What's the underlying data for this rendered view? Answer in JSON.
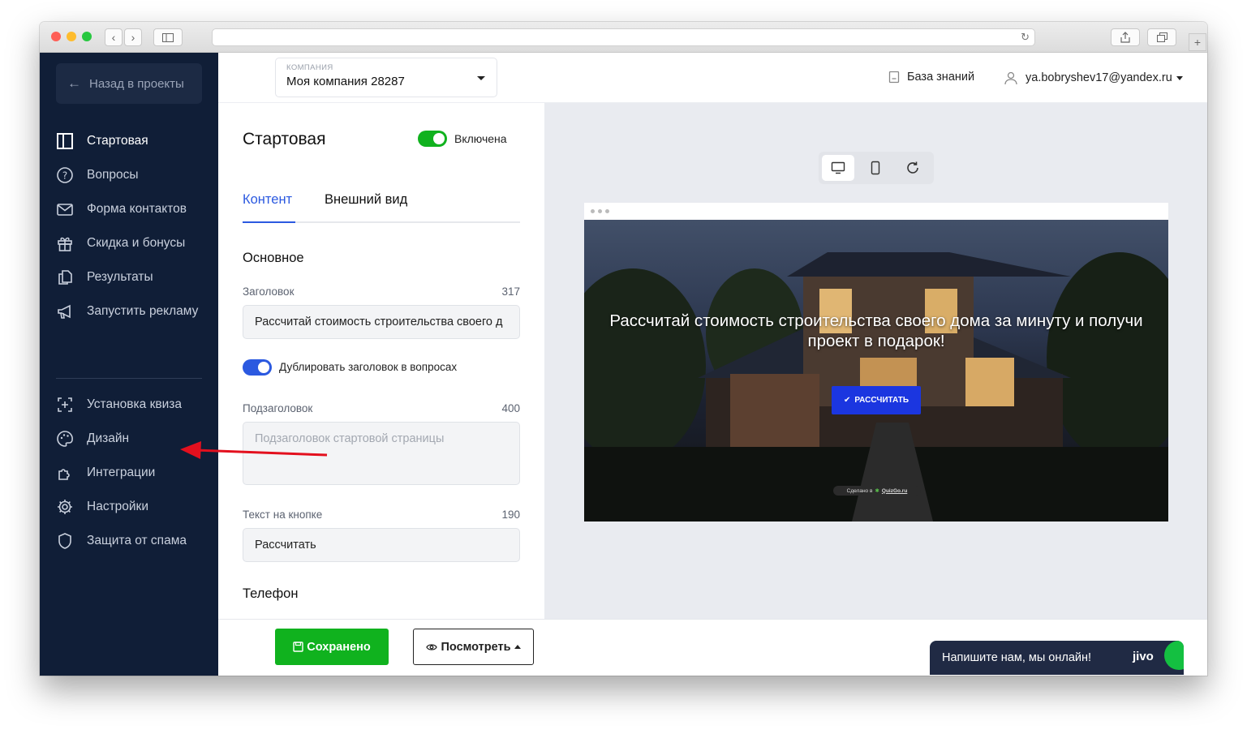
{
  "sidebar": {
    "back_label": "Назад в проекты",
    "items": [
      {
        "label": "Стартовая"
      },
      {
        "label": "Вопросы"
      },
      {
        "label": "Форма контактов"
      },
      {
        "label": "Скидка и бонусы"
      },
      {
        "label": "Результаты"
      },
      {
        "label": "Запустить рекламу"
      },
      {
        "label": "Установка квиза"
      },
      {
        "label": "Дизайн"
      },
      {
        "label": "Интеграции"
      },
      {
        "label": "Настройки"
      },
      {
        "label": "Защита от спама"
      }
    ]
  },
  "header": {
    "company_caption": "КОМПАНИЯ",
    "company_name": "Моя компания 28287",
    "knowledge_base": "База знаний",
    "user_email": "ya.bobryshev17@yandex.ru"
  },
  "editor": {
    "title": "Стартовая",
    "enabled_label": "Включена",
    "tabs": [
      {
        "label": "Контент"
      },
      {
        "label": "Внешний вид"
      }
    ],
    "section_main": "Основное",
    "headline_label": "Заголовок",
    "headline_count": "317",
    "headline_value": "Рассчитай стоимость строительства своего д",
    "duplicate_label": "Дублировать заголовок в вопросах",
    "subheadline_label": "Подзаголовок",
    "subheadline_count": "400",
    "subheadline_placeholder": "Подзаголовок стартовой страницы",
    "button_text_label": "Текст на кнопке",
    "button_text_count": "190",
    "button_text_value": "Рассчитать",
    "section_phone": "Телефон"
  },
  "bottom": {
    "save_label": "Сохранено",
    "view_label": "Посмотреть"
  },
  "preview": {
    "headline": "Рассчитай стоимость строительства своего дома за минуту и получи проект в подарок!",
    "cta": "РАССЧИТАТЬ",
    "made_in": "Сделано в",
    "brand": "QuizGo.ru"
  },
  "chat": {
    "text": "Напишите нам, мы онлайн!",
    "brand": "jivo"
  },
  "colors": {
    "sidebar_bg": "#101e37",
    "accent_blue": "#2b59e0",
    "toggle_green": "#10b21e",
    "save_green": "#10b21e"
  }
}
